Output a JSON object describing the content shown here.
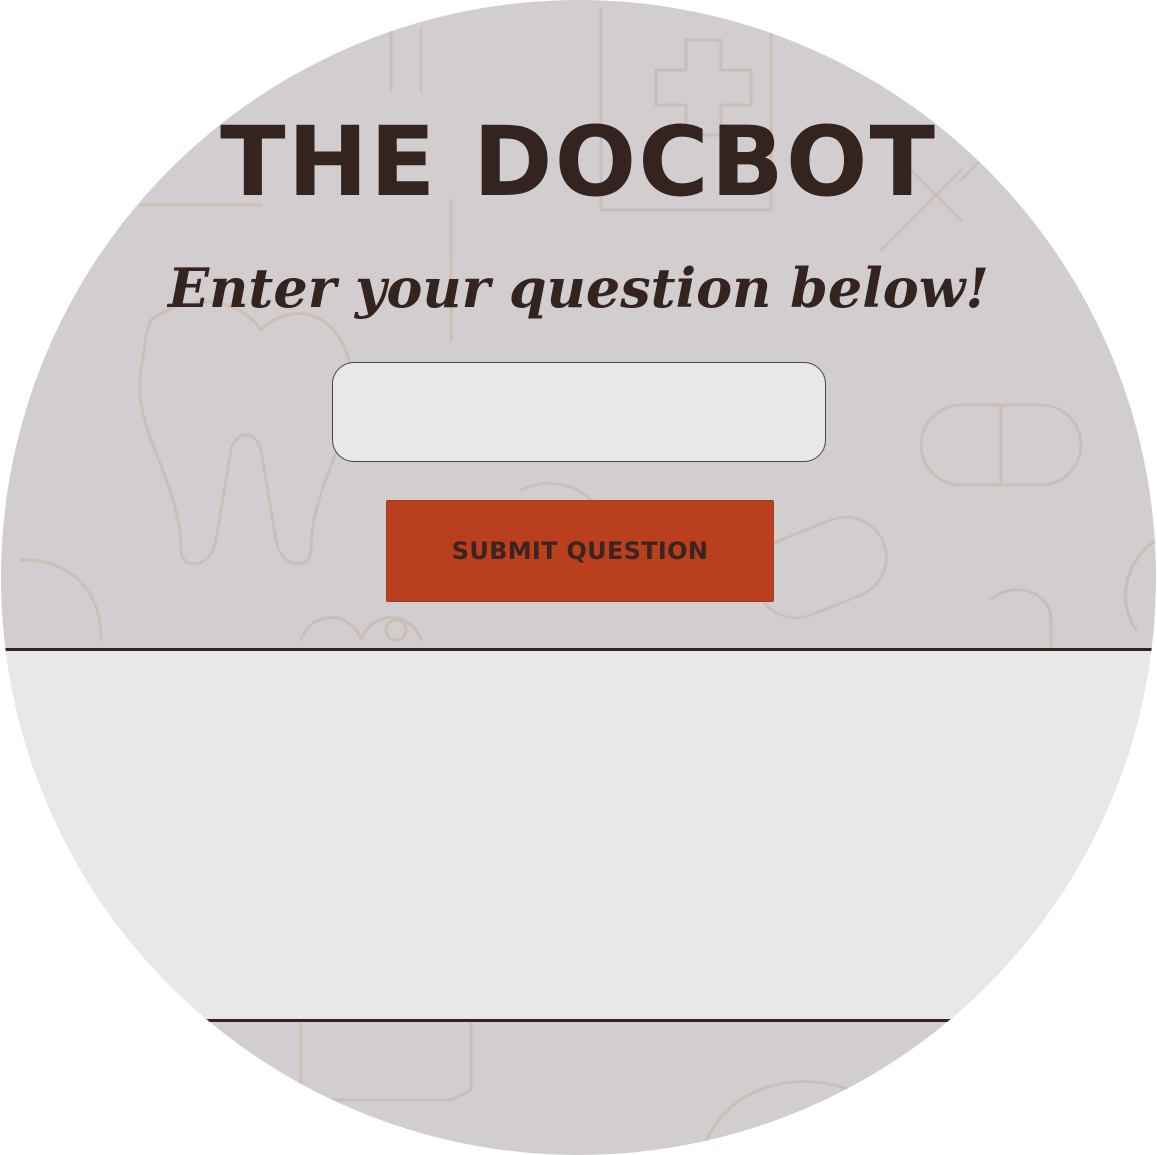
{
  "app": {
    "title": "THE DOCBOT",
    "subtitle": "Enter your question below!"
  },
  "form": {
    "question_value": "",
    "question_placeholder": "",
    "submit_label": "SUBMIT QUESTION"
  },
  "answer": {
    "text": ""
  },
  "colors": {
    "background": "#d2cecf",
    "text": "#33241f",
    "accent": "#b93f1e",
    "panel": "#e9e8e8",
    "doodle": "#c9b8ae"
  },
  "icons": [
    "tooth-icon",
    "pill-icon",
    "medical-cross-icon",
    "stethoscope-icon",
    "heart-icon",
    "syringe-icon"
  ]
}
